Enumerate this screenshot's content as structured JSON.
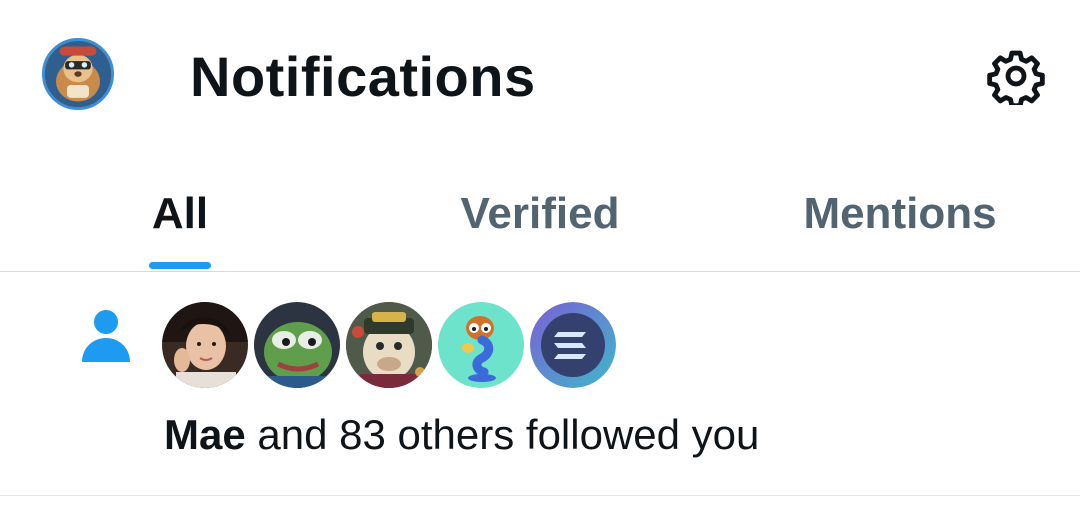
{
  "header": {
    "title": "Notifications",
    "profile_avatar_icon": "user-avatar",
    "settings_icon": "gear-icon"
  },
  "tabs": [
    {
      "label": "All",
      "active": true
    },
    {
      "label": "Verified",
      "active": false
    },
    {
      "label": "Mentions",
      "active": false
    }
  ],
  "notification": {
    "type_icon": "person-icon",
    "actor": "Mae",
    "rest": " and 83 others followed you",
    "avatar_icons": [
      "girl-photo-avatar",
      "pepe-frog-avatar",
      "ape-nft-avatar",
      "cartoon-character-avatar",
      "solana-logo-avatar"
    ]
  },
  "colors": {
    "accent": "#1d9bf0",
    "text_primary": "#0f1419",
    "text_secondary": "#536471",
    "divider": "#d7dbdf"
  }
}
